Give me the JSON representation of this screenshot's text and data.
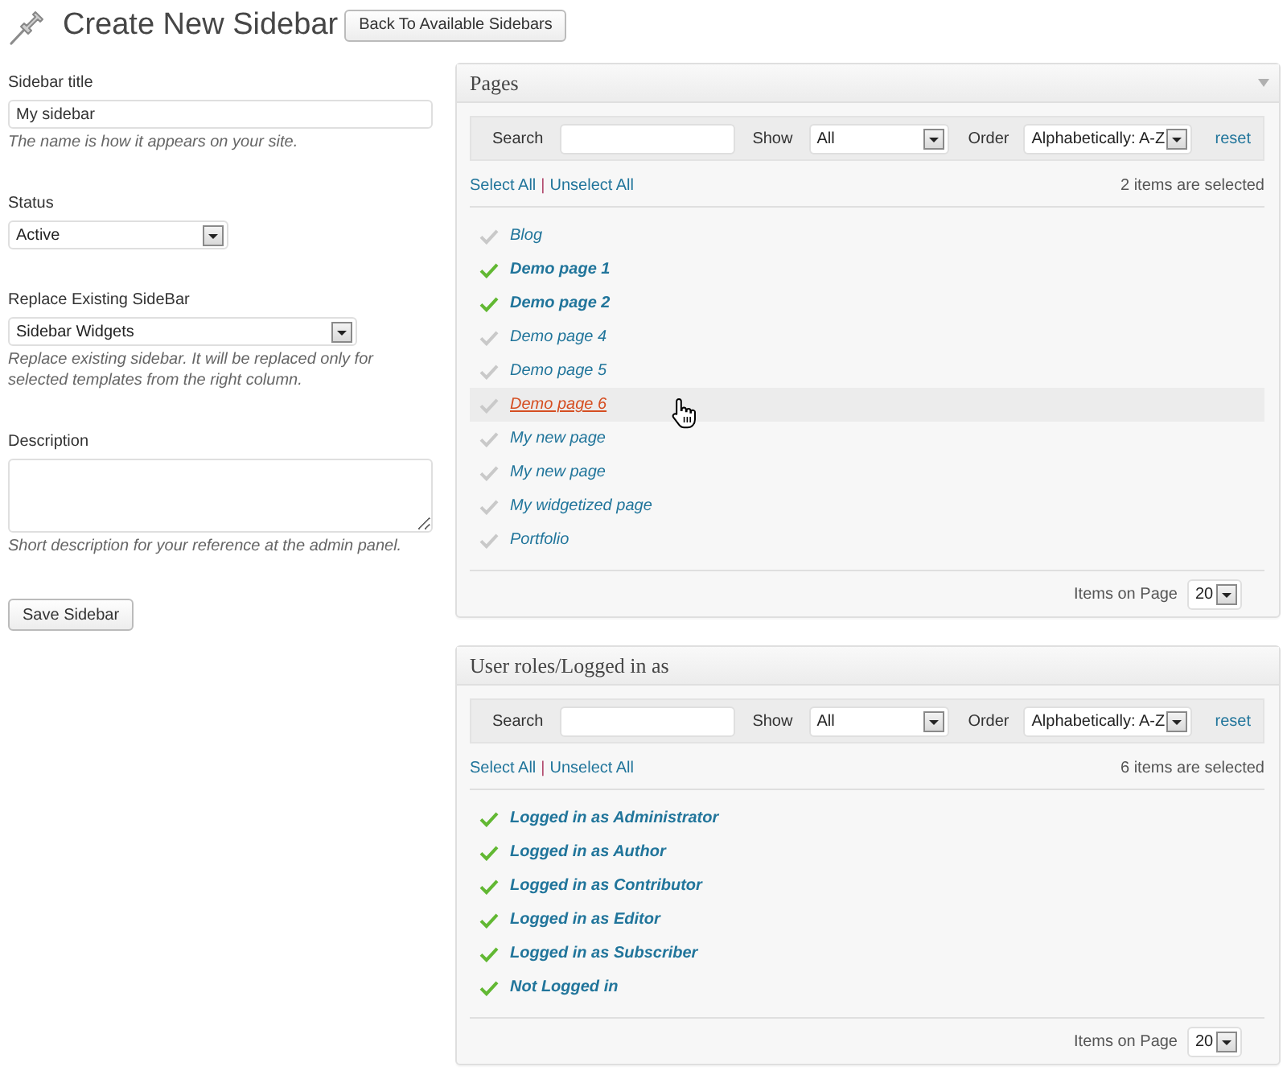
{
  "header": {
    "title": "Create New Sidebar",
    "back_button": "Back To Available Sidebars"
  },
  "form": {
    "fields": [
      {
        "kind": "text",
        "label": "Sidebar title",
        "value": "My sidebar",
        "hint": "The name is how it appears on your site."
      },
      {
        "kind": "select",
        "label": "Status",
        "value": "Active"
      },
      {
        "kind": "select",
        "label": "Replace Existing SideBar",
        "value": "Sidebar Widgets",
        "hint": "Replace existing sidebar. It will be replaced only for selected templates from the right column."
      },
      {
        "kind": "textarea",
        "label": "Description",
        "hint": "Short description for your reference at the admin panel."
      }
    ],
    "save_button": "Save Sidebar"
  },
  "panels": [
    {
      "title": "Pages",
      "toggle_arrow": true,
      "filters": {
        "search_label": "Search",
        "show_label": "Show",
        "show_value": "All",
        "order_label": "Order",
        "order_value": "Alphabetically: A-Z",
        "reset": "reset"
      },
      "select_all": "Select All",
      "separator": "|",
      "unselect_all": "Unselect All",
      "selected_count": "2 items are selected",
      "items": [
        {
          "label": "Blog",
          "checked": false,
          "hovered": false
        },
        {
          "label": "Demo page 1",
          "checked": true,
          "hovered": false
        },
        {
          "label": "Demo page 2",
          "checked": true,
          "hovered": false
        },
        {
          "label": "Demo page 4",
          "checked": false,
          "hovered": false
        },
        {
          "label": "Demo page 5",
          "checked": false,
          "hovered": false
        },
        {
          "label": "Demo page 6",
          "checked": false,
          "hovered": true
        },
        {
          "label": "My new page",
          "checked": false,
          "hovered": false
        },
        {
          "label": "My new page",
          "checked": false,
          "hovered": false
        },
        {
          "label": "My widgetized page",
          "checked": false,
          "hovered": false
        },
        {
          "label": "Portfolio",
          "checked": false,
          "hovered": false
        }
      ],
      "per_page_label": "Items on Page",
      "per_page_value": "20"
    },
    {
      "title": "User roles/Logged in as",
      "toggle_arrow": false,
      "filters": {
        "search_label": "Search",
        "show_label": "Show",
        "show_value": "All",
        "order_label": "Order",
        "order_value": "Alphabetically: A-Z",
        "reset": "reset"
      },
      "select_all": "Select All",
      "separator": "|",
      "unselect_all": "Unselect All",
      "selected_count": "6 items are selected",
      "items": [
        {
          "label": "Logged in as Administrator",
          "checked": true,
          "hovered": false
        },
        {
          "label": "Logged in as Author",
          "checked": true,
          "hovered": false
        },
        {
          "label": "Logged in as Contributor",
          "checked": true,
          "hovered": false
        },
        {
          "label": "Logged in as Editor",
          "checked": true,
          "hovered": false
        },
        {
          "label": "Logged in as Subscriber",
          "checked": true,
          "hovered": false
        },
        {
          "label": "Not Logged in",
          "checked": true,
          "hovered": false
        }
      ],
      "per_page_label": "Items on Page",
      "per_page_value": "20"
    }
  ]
}
